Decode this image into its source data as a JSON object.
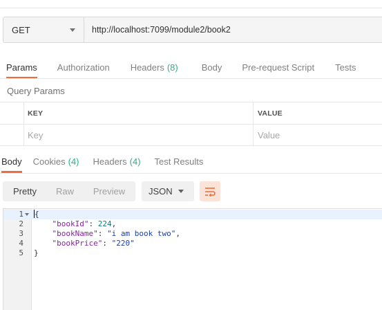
{
  "request": {
    "method": "GET",
    "url": "http://localhost:7099/module2/book2"
  },
  "request_tabs": [
    {
      "label": "Params",
      "count": "",
      "active": true
    },
    {
      "label": "Authorization",
      "count": ""
    },
    {
      "label": "Headers",
      "count": "(8)"
    },
    {
      "label": "Body",
      "count": ""
    },
    {
      "label": "Pre-request Script",
      "count": ""
    },
    {
      "label": "Tests",
      "count": ""
    }
  ],
  "query_params": {
    "title": "Query Params",
    "key_header": "KEY",
    "value_header": "VALUE",
    "key_placeholder": "Key",
    "value_placeholder": "Value"
  },
  "response_tabs": [
    {
      "label": "Body",
      "count": "",
      "active": true
    },
    {
      "label": "Cookies",
      "count": "(4)"
    },
    {
      "label": "Headers",
      "count": "(4)"
    },
    {
      "label": "Test Results",
      "count": ""
    }
  ],
  "view_modes": [
    "Pretty",
    "Raw",
    "Preview"
  ],
  "active_view_mode": "Pretty",
  "format": "JSON",
  "colors": {
    "accent": "#f26b3a",
    "count": "#26b47f",
    "json_key": "#8b1fa9",
    "json_string": "#1c3fa8",
    "json_number": "#0b7d7a"
  },
  "response_body": {
    "line_numbers": [
      "1",
      "2",
      "3",
      "4",
      "5"
    ],
    "open_brace": "{",
    "close_brace": "}",
    "fields": [
      {
        "key": "\"bookId\"",
        "value": "224",
        "type": "number"
      },
      {
        "key": "\"bookName\"",
        "value": "\"i am book two\"",
        "type": "string"
      },
      {
        "key": "\"bookPrice\"",
        "value": "\"220\"",
        "type": "string"
      }
    ]
  }
}
